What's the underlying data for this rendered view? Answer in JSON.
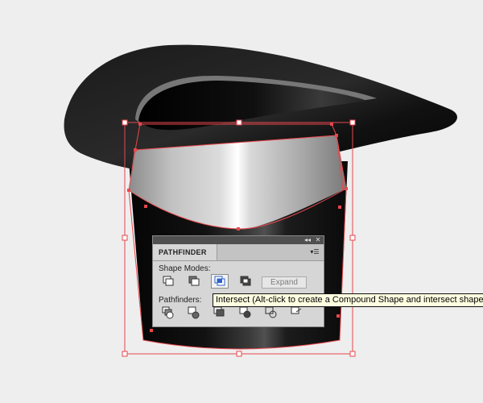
{
  "panel": {
    "collapse_icon": "double-chevron-left-icon",
    "close_icon": "close-icon",
    "tab_label": "PATHFINDER",
    "menu_icon": "panel-menu-icon",
    "shape_modes_label": "Shape Modes:",
    "shape_modes": [
      {
        "name": "unite-icon"
      },
      {
        "name": "minus-front-icon"
      },
      {
        "name": "intersect-icon",
        "selected": true
      },
      {
        "name": "exclude-icon"
      }
    ],
    "expand_label": "Expand",
    "pathfinders_label": "Pathfinders:",
    "pathfinders": [
      {
        "name": "divide-icon"
      },
      {
        "name": "trim-icon"
      },
      {
        "name": "merge-icon"
      },
      {
        "name": "crop-icon"
      },
      {
        "name": "outline-icon"
      },
      {
        "name": "minus-back-icon"
      }
    ]
  },
  "tooltip": {
    "text": "Intersect (Alt-click to create a Compound Shape and intersect shape a"
  },
  "colors": {
    "background": "#eeeeee",
    "selection": "#e8474c",
    "panel": "#d6d6d6",
    "tooltip_bg": "#ffffe1"
  }
}
